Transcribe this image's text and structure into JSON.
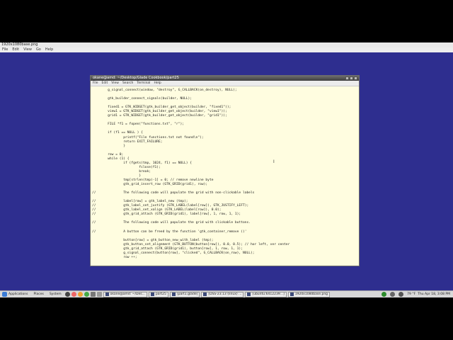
{
  "app": {
    "title": "1920x1080base.png",
    "menu": [
      "File",
      "Edit",
      "View",
      "Go",
      "Help"
    ]
  },
  "terminal": {
    "title": "okane@amd: ~/Desktop/Glade Cookbook/part25",
    "menu": [
      "File",
      "Edit",
      "View",
      "Search",
      "Terminal",
      "Help"
    ],
    "code_lines": [
      "        g_signal_connect(window, \"destroy\", G_CALLBACK(on_destroy), NULL);",
      "",
      "        gtk_builder_connect_signals(builder, NULL);",
      "",
      "        fixed1 = GTK_WIDGET(gtk_builder_get_object(builder, \"fixed1\"));",
      "        view1 = GTK_WIDGET(gtk_builder_get_object(builder, \"view1\"));",
      "        grid1 = GTK_WIDGET(gtk_builder_get_object(builder, \"grid1\"));",
      "",
      "        FILE *f1 = fopen(\"functions.txt\", \"r\");",
      "",
      "        if (f1 == NULL ) {",
      "                printf(\"File functions.txt not found\\n\");",
      "                return EXIT_FAILURE;",
      "                }",
      "",
      "        row = 0;",
      "        while (1) {",
      "                if (fgets(tmp, 1024, f1) == NULL) {",
      "                        fclose(f1);",
      "                        break;",
      "                        }",
      "                tmp[strlen(tmp)-1] = 0; // remove newline byte",
      "                gtk_grid_insert_row (GTK_GRID(grid1), row);",
      "",
      "//              The following code will populate the grid with non-clickable labels",
      "",
      "//              label[row] = gtk_label_new (tmp);",
      "//              gtk_label_set_justify (GTK_LABEL(label[row]), GTK_JUSTIFY_LEFT);",
      "//              gtk_label_set_xalign (GTK_LABEL(label[row]), 0.0);",
      "//              gtk_grid_attach (GTK_GRID(grid1), label[row], 1, row, 1, 1);",
      "",
      "//              The following code will populate the grid with clickable buttons.",
      "",
      "//              A button can be freed by the function 'gtk_container_remove ()'",
      "",
      "                button[row] = gtk_button_new_with_label (tmp);",
      "                gtk_button_set_alignment (GTK_BUTTON(button[row]), 0.0, 0.5); // hor left, ver center",
      "                gtk_grid_attach (GTK_GRID(grid1), button[row], 1, row, 1, 1);",
      "                g_signal_connect(button[row], \"clicked\", G_CALLBACK(on_row), NULL);",
      "                row ++;"
    ]
  },
  "taskbar": {
    "menus": [
      "Applications",
      "Places",
      "System"
    ],
    "tasks": [
      "okane@amd: ~/Des...",
      "part25",
      "[part1.glade]",
      "[DSS-23.13 (linux) ...",
      "[ubuntu:6412239...]",
      "1920x1080base.png"
    ],
    "tray": {
      "temp": "79 °F",
      "clock": "Thu Apr 18, 3:08 PM"
    },
    "colors": {
      "desktop": "#2e2e8f",
      "terminal_bg": "#fffde0"
    }
  }
}
